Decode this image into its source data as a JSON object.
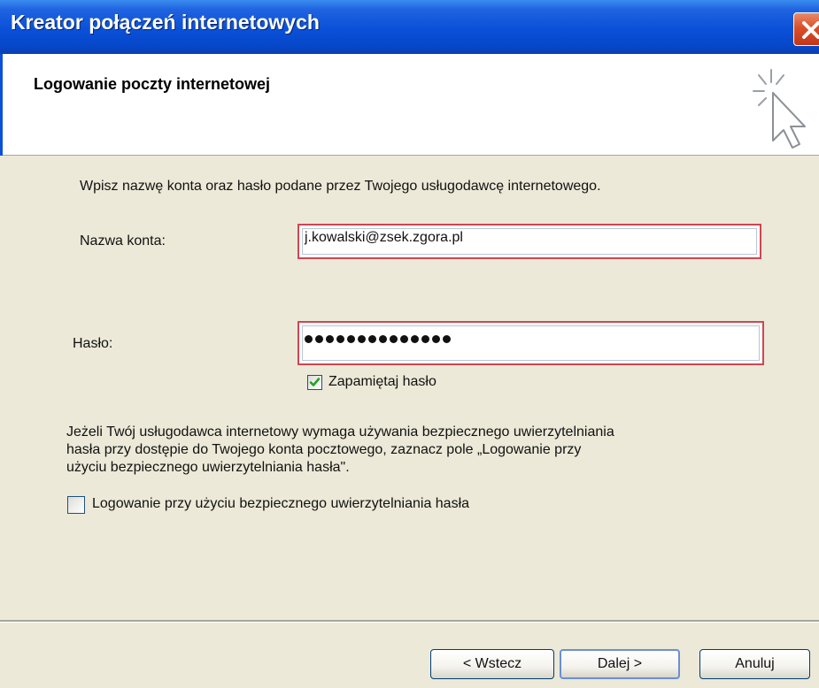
{
  "window": {
    "title": "Kreator połączeń internetowych"
  },
  "header": {
    "title": "Logowanie poczty internetowej"
  },
  "body": {
    "instruction": "Wpisz nazwę konta oraz hasło podane przez Twojego usługodawcę internetowego.",
    "account_label": "Nazwa konta:",
    "account_value": "j.kowalski@zsek.zgora.pl",
    "password_label": "Hasło:",
    "password_masked_length": 14,
    "remember_label": "Zapamiętaj hasło",
    "remember_checked": true,
    "spa_paragraph": [
      "Jeżeli Twój usługodawca internetowy wymaga używania bezpiecznego uwierzytelniania",
      "hasła przy dostępie do Twojego konta pocztowego, zaznacz pole „Logowanie przy",
      "użyciu bezpiecznego uwierzytelniania hasła\"."
    ],
    "spa_label": "Logowanie przy użyciu bezpiecznego uwierzytelniania hasła",
    "spa_checked": false
  },
  "buttons": {
    "back": "< Wstecz",
    "next": "Dalej >",
    "cancel": "Anuluj"
  },
  "colors": {
    "title_bar": "#0a50d8",
    "dialog_bg": "#ece9d8",
    "highlight_border": "#cf4652",
    "check_mark": "#21a121"
  },
  "icons": {
    "close": "close-icon",
    "wizard": "wizard-cursor-icon",
    "check": "checkmark-icon"
  }
}
